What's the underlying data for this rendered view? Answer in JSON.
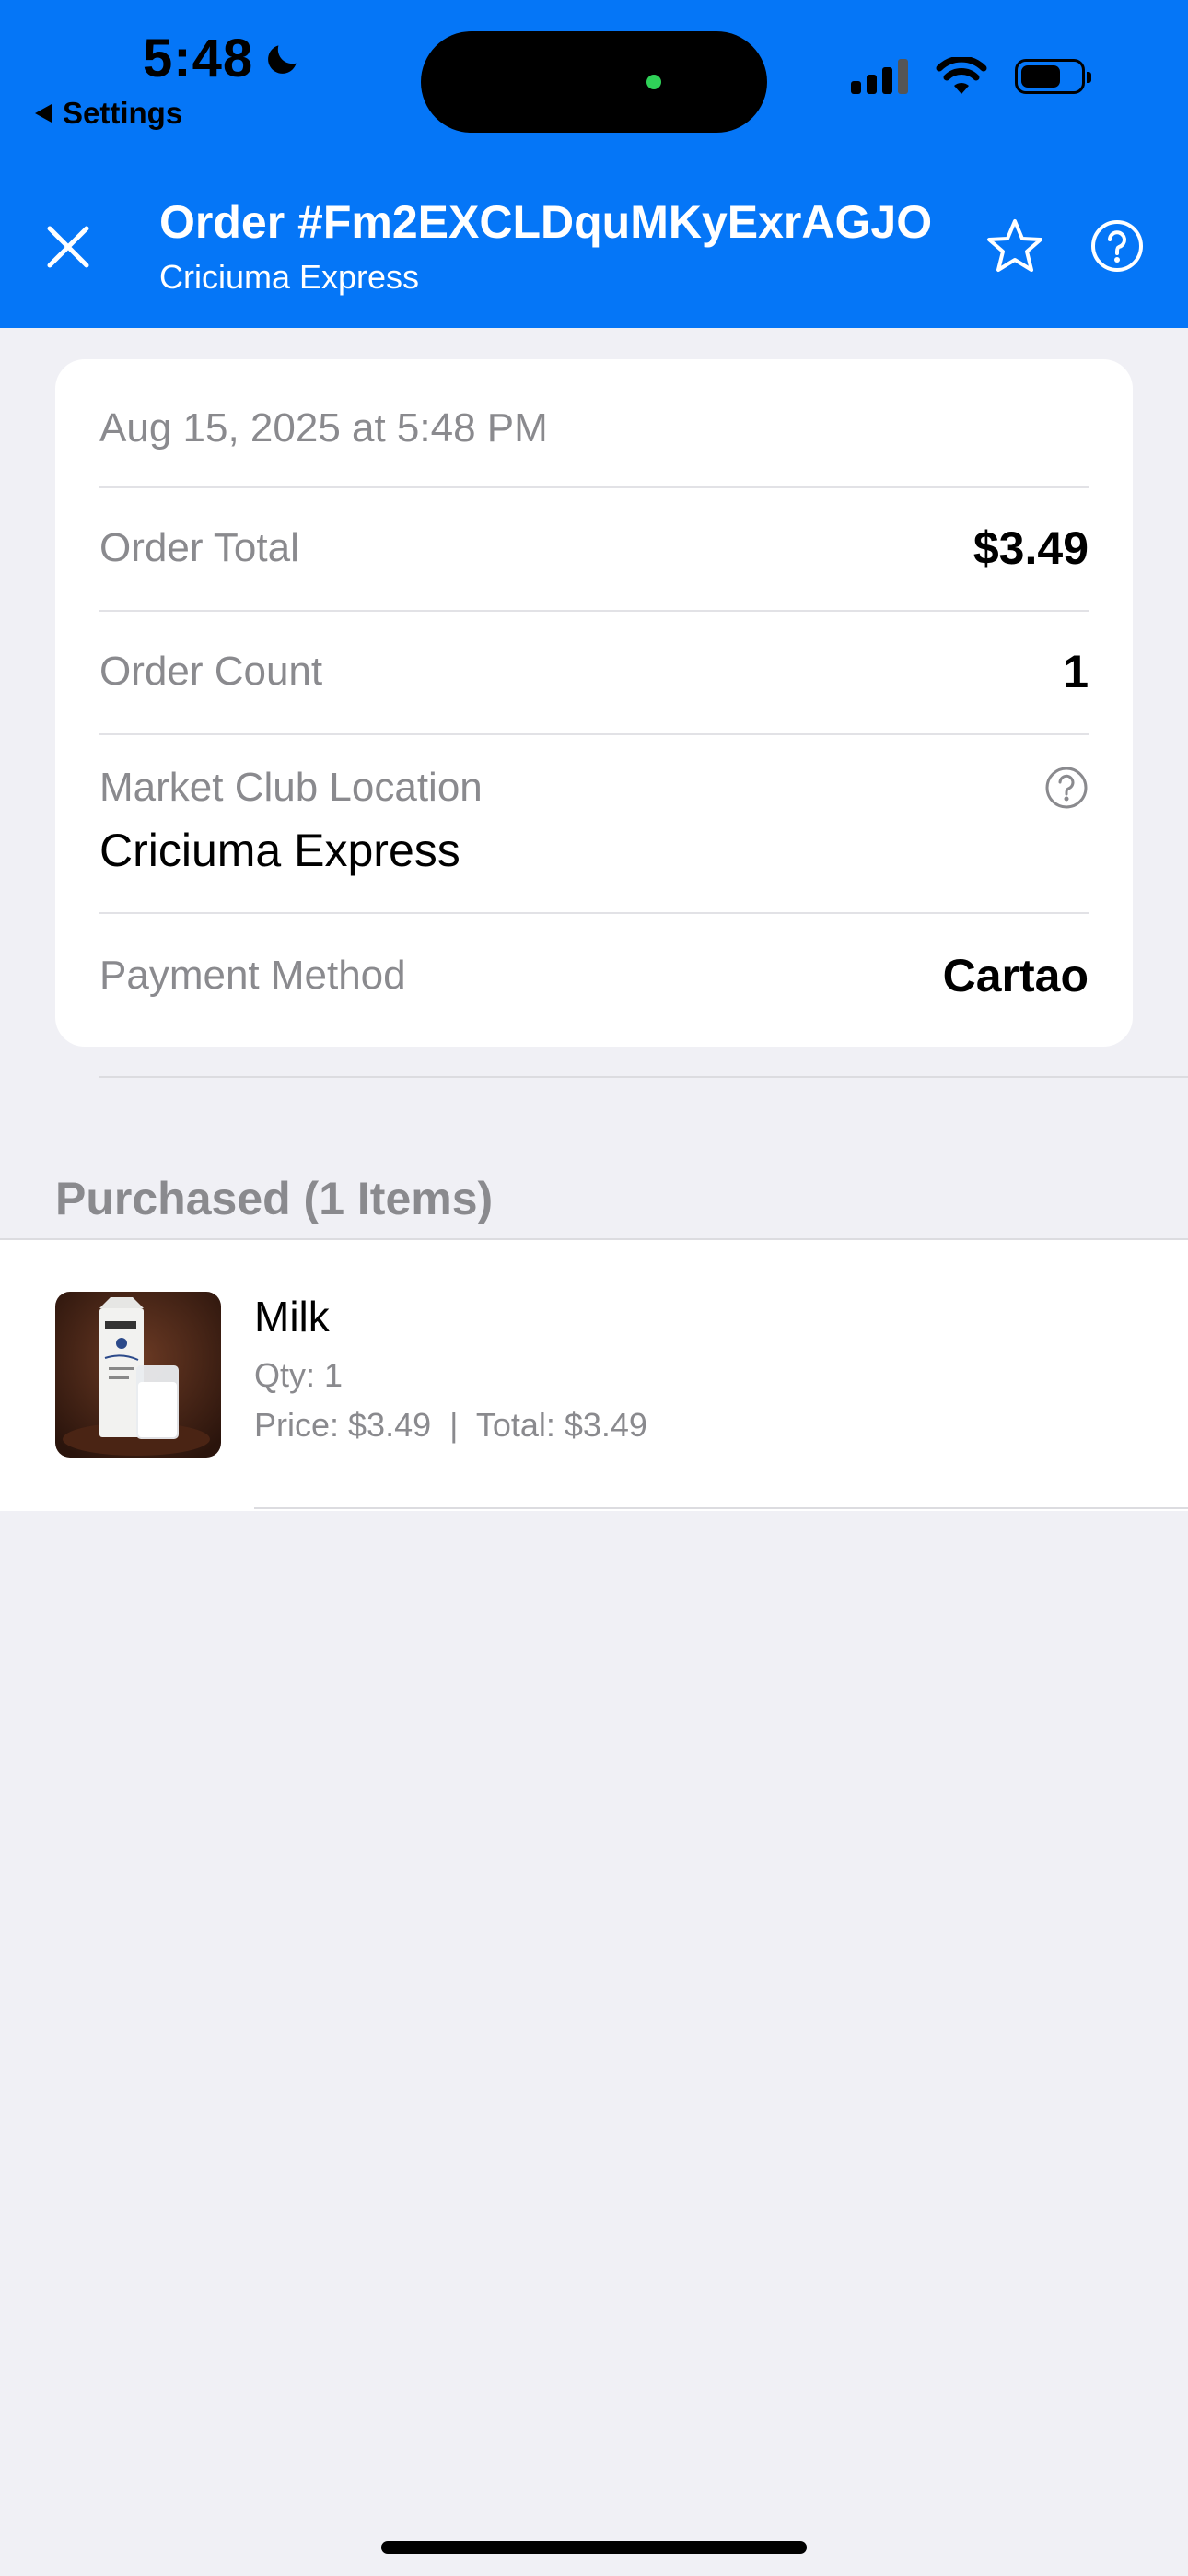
{
  "status_bar": {
    "time": "5:48",
    "back_app": "Settings"
  },
  "header": {
    "title": "Order #Fm2EXCLDquMKyExrAGJO",
    "subtitle": "Criciuma Express",
    "background_color": "#0576f7"
  },
  "order_card": {
    "date": "Aug 15, 2025 at 5:48 PM",
    "total_label": "Order Total",
    "total_value": "$3.49",
    "count_label": "Order Count",
    "count_value": "1",
    "location_label": "Market Club Location",
    "location_value": "Criciuma Express",
    "payment_label": "Payment Method",
    "payment_value": "Cartao"
  },
  "purchased": {
    "section_title": "Purchased (1 Items)",
    "items": [
      {
        "name": "Milk",
        "qty": "Qty: 1",
        "price_line": "Price: $3.49  |  Total: $3.49",
        "image_icon": "milk-carton-photo"
      }
    ]
  }
}
